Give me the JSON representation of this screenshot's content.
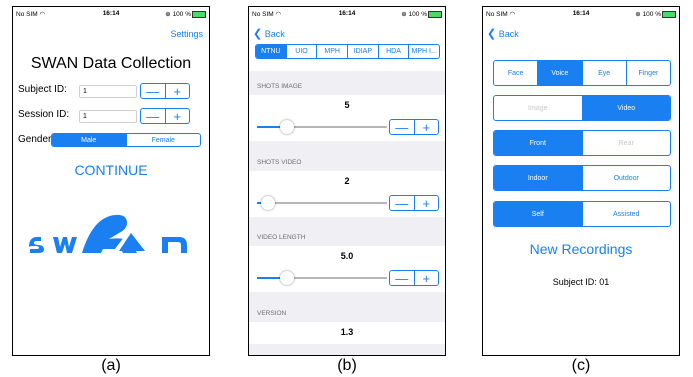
{
  "status": {
    "carrier": "No SIM",
    "time": "16:14",
    "battery": "100 %"
  },
  "colors": {
    "accent": "#1a7ff0"
  },
  "a": {
    "settings": "Settings",
    "title": "SWAN Data Collection",
    "subject_label": "Subject ID:",
    "subject_value": "1",
    "session_label": "Session ID:",
    "session_value": "1",
    "gender_label": "Gender",
    "gender_options": [
      "Male",
      "Female"
    ],
    "gender_selected": "Male",
    "continue": "CONTINUE",
    "logo_text": "swan",
    "caption": "(a)"
  },
  "b": {
    "back": "Back",
    "tabs": [
      "NTNU",
      "UIO",
      "MPH",
      "IDIAP",
      "HDA",
      "MPH I..."
    ],
    "tab_selected": "NTNU",
    "shots_image_label": "SHOTS IMAGE",
    "shots_image_value": "5",
    "shots_video_label": "SHOTS VIDEO",
    "shots_video_value": "2",
    "video_length_label": "VIDEO LENGTH",
    "video_length_value": "5.0",
    "version_label": "VERSION",
    "version_value": "1.3",
    "caption": "(b)"
  },
  "c": {
    "back": "Back",
    "modality": [
      "Face",
      "Voice",
      "Eye",
      "Finger"
    ],
    "modality_selected": "Voice",
    "media": [
      "Image",
      "Video"
    ],
    "media_selected": "Video",
    "camera": [
      "Front",
      "Rear"
    ],
    "camera_selected": "Front",
    "location": [
      "Indoor",
      "Outdoor"
    ],
    "location_selected": "Indoor",
    "mode": [
      "Self",
      "Assisted"
    ],
    "mode_selected": "Self",
    "new_recordings": "New Recordings",
    "subject": "Subject ID: 01",
    "caption": "(c)"
  },
  "stepper_minus": "—",
  "stepper_plus": "+",
  "icons": {
    "wifi": "wifi-icon",
    "back": "chevron-left-icon",
    "lock": "rotation-lock-icon"
  }
}
